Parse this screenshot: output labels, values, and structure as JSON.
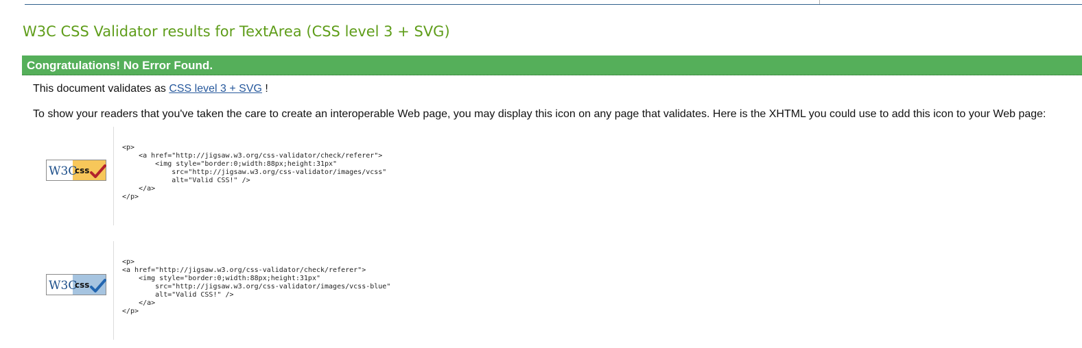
{
  "header": {
    "title": "W3C CSS Validator results for TextArea (CSS level 3 + SVG)"
  },
  "banner": {
    "text": "Congratulations! No Error Found."
  },
  "validation": {
    "prefix": "This document validates as",
    "profile_link": "CSS level 3 + SVG",
    "suffix": "!"
  },
  "instructions": "To show your readers that you've taken the care to create an interoperable Web page, you may display this icon on any page that validates. Here is the XHTML you could use to add this icon to your Web page:",
  "badges": [
    {
      "variant": "gold",
      "w3c_text": "W3C",
      "css_text": "css",
      "accent_color": "#f7c75a",
      "check_color": "#b3222c",
      "code": "<p>\n    <a href=\"http://jigsaw.w3.org/css-validator/check/referer\">\n        <img style=\"border:0;width:88px;height:31px\"\n            src=\"http://jigsaw.w3.org/css-validator/images/vcss\"\n            alt=\"Valid CSS!\" />\n    </a>\n</p>"
    },
    {
      "variant": "blue",
      "w3c_text": "W3C",
      "css_text": "css",
      "accent_color": "#a6c4e0",
      "check_color": "#2366b0",
      "code": "<p>\n<a href=\"http://jigsaw.w3.org/css-validator/check/referer\">\n    <img style=\"border:0;width:88px;height:31px\"\n        src=\"http://jigsaw.w3.org/css-validator/images/vcss-blue\"\n        alt=\"Valid CSS!\" />\n    </a>\n</p>"
    }
  ],
  "colors": {
    "title": "#5f9d1a",
    "banner": "#55af5a",
    "link": "#26589c"
  }
}
